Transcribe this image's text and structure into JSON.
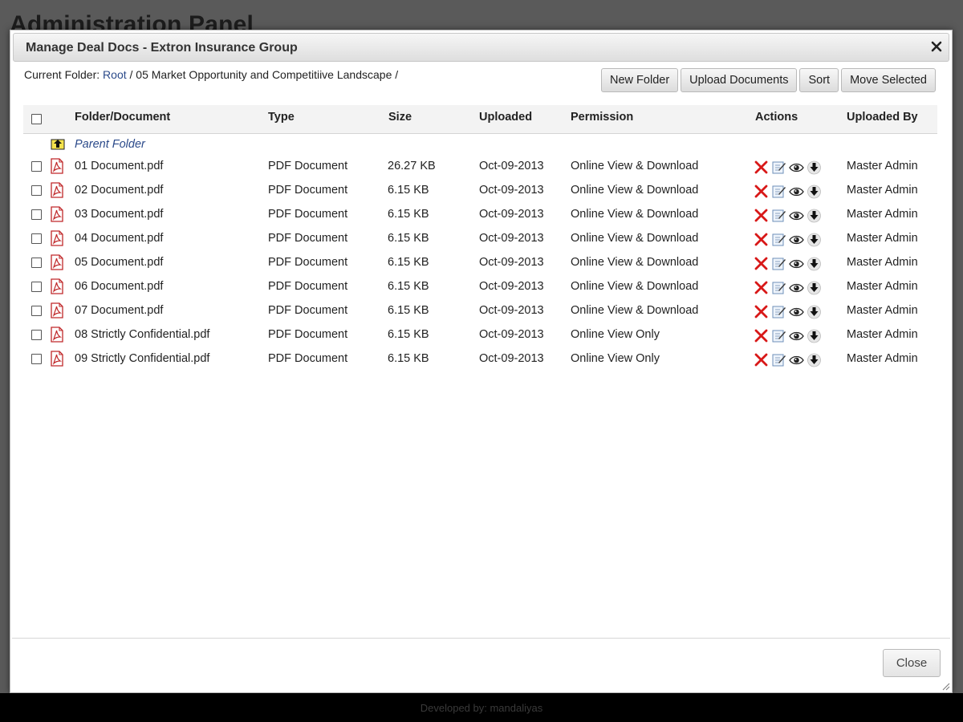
{
  "background": {
    "title": "Administration Panel",
    "footer": "Developed by: mandaliyas"
  },
  "dialog": {
    "title": "Manage Deal Docs - Extron Insurance Group",
    "close_label": "Close"
  },
  "breadcrumb": {
    "label": "Current Folder:",
    "root": "Root",
    "sep": "/",
    "path": "05 Market Opportunity and Competitiive Landscape /"
  },
  "toolbar": {
    "new_folder": "New Folder",
    "upload": "Upload Documents",
    "sort": "Sort",
    "move": "Move Selected"
  },
  "table": {
    "headers": {
      "name": "Folder/Document",
      "type": "Type",
      "size": "Size",
      "uploaded": "Uploaded",
      "permission": "Permission",
      "actions": "Actions",
      "uploaded_by": "Uploaded By"
    },
    "parent_folder": "Parent Folder",
    "rows": [
      {
        "name": "01 Document.pdf",
        "type": "PDF Document",
        "size": "26.27 KB",
        "uploaded": "Oct-09-2013",
        "permission": "Online View & Download",
        "uploaded_by": "Master Admin"
      },
      {
        "name": "02 Document.pdf",
        "type": "PDF Document",
        "size": "6.15 KB",
        "uploaded": "Oct-09-2013",
        "permission": "Online View & Download",
        "uploaded_by": "Master Admin"
      },
      {
        "name": "03 Document.pdf",
        "type": "PDF Document",
        "size": "6.15 KB",
        "uploaded": "Oct-09-2013",
        "permission": "Online View & Download",
        "uploaded_by": "Master Admin"
      },
      {
        "name": "04 Document.pdf",
        "type": "PDF Document",
        "size": "6.15 KB",
        "uploaded": "Oct-09-2013",
        "permission": "Online View & Download",
        "uploaded_by": "Master Admin"
      },
      {
        "name": "05 Document.pdf",
        "type": "PDF Document",
        "size": "6.15 KB",
        "uploaded": "Oct-09-2013",
        "permission": "Online View & Download",
        "uploaded_by": "Master Admin"
      },
      {
        "name": "06 Document.pdf",
        "type": "PDF Document",
        "size": "6.15 KB",
        "uploaded": "Oct-09-2013",
        "permission": "Online View & Download",
        "uploaded_by": "Master Admin"
      },
      {
        "name": "07 Document.pdf",
        "type": "PDF Document",
        "size": "6.15 KB",
        "uploaded": "Oct-09-2013",
        "permission": "Online View & Download",
        "uploaded_by": "Master Admin"
      },
      {
        "name": "08 Strictly Confidential.pdf",
        "type": "PDF Document",
        "size": "6.15 KB",
        "uploaded": "Oct-09-2013",
        "permission": "Online View Only",
        "uploaded_by": "Master Admin"
      },
      {
        "name": "09 Strictly Confidential.pdf",
        "type": "PDF Document",
        "size": "6.15 KB",
        "uploaded": "Oct-09-2013",
        "permission": "Online View Only",
        "uploaded_by": "Master Admin"
      }
    ]
  },
  "icons": {
    "file": "pdf-icon",
    "parent": "folder-up-icon",
    "actions": [
      "delete-icon",
      "edit-icon",
      "view-icon",
      "download-icon"
    ]
  },
  "colors": {
    "link": "#2b4a8a",
    "delete": "#d81818",
    "pdf": "#c0282a"
  }
}
